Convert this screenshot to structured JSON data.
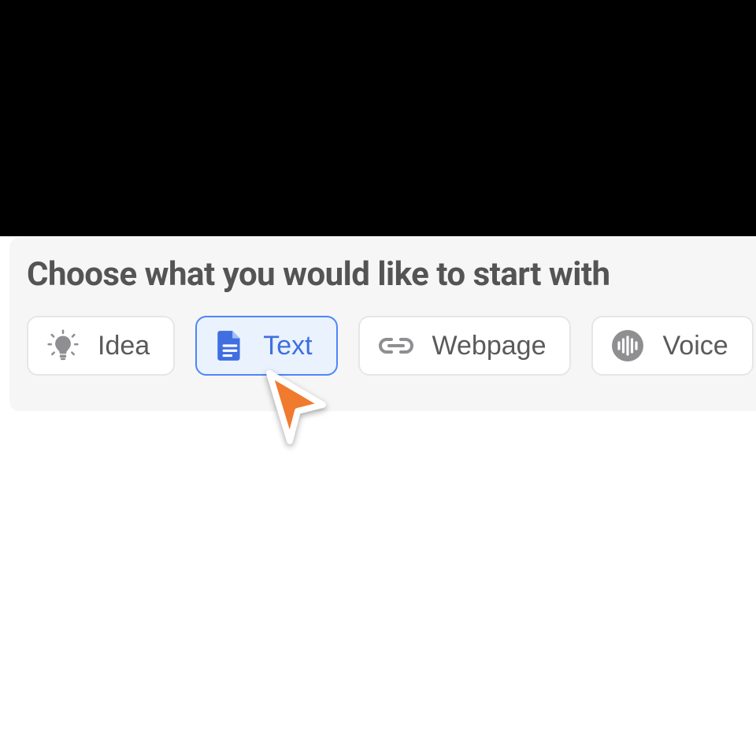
{
  "heading": "Choose what you would like to start with",
  "options": [
    {
      "label": "Idea",
      "icon": "lightbulb-icon",
      "selected": false
    },
    {
      "label": "Text",
      "icon": "document-icon",
      "selected": true
    },
    {
      "label": "Webpage",
      "icon": "link-icon",
      "selected": false
    },
    {
      "label": "Voice",
      "icon": "audio-icon",
      "selected": false
    }
  ],
  "colors": {
    "accent": "#4f86f7",
    "accent_bg": "#eaf2fe",
    "text": "#545454",
    "icon_muted": "#8f8f92",
    "cursor": "#f07a2e"
  }
}
